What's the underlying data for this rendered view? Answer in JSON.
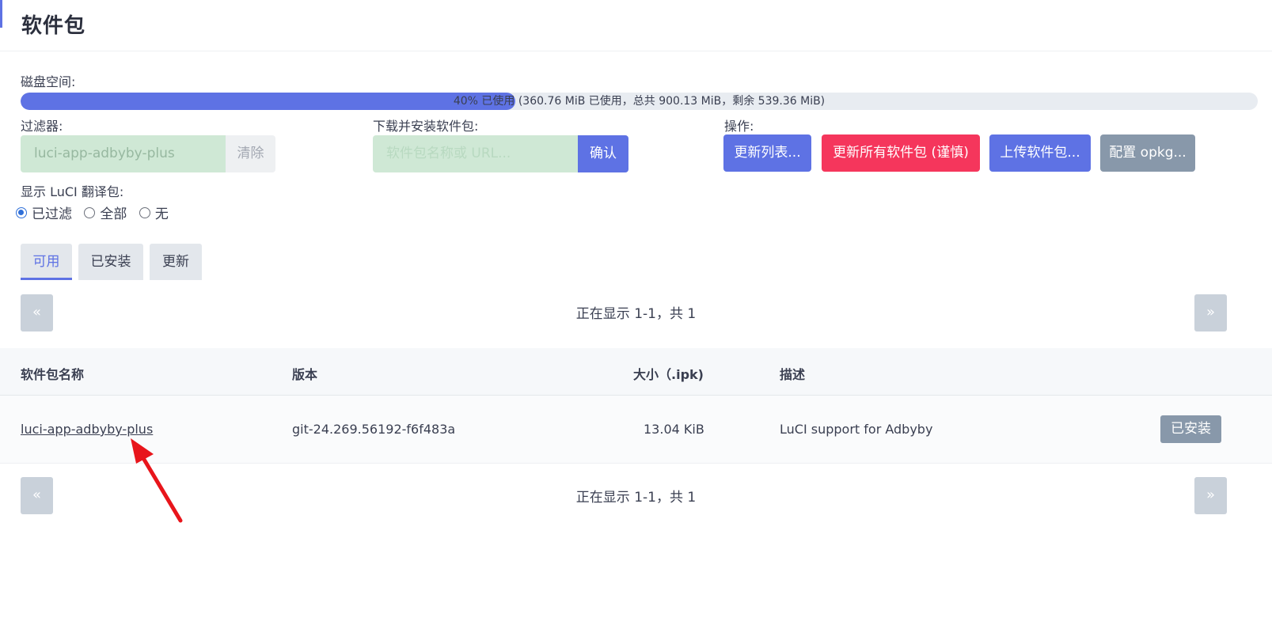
{
  "page": {
    "title": "软件包"
  },
  "disk": {
    "label": "磁盘空间:",
    "usage_text": "40% 已使用 (360.76 MiB 已使用，总共 900.13 MiB，剩余 539.36 MiB)",
    "used_percent": 40,
    "fill_color": "#5e72e4"
  },
  "filter": {
    "label": "过滤器:",
    "value": "luci-app-adbyby-plus",
    "clear_label": "清除"
  },
  "install": {
    "label": "下载并安装软件包:",
    "placeholder": "软件包名称或 URL...",
    "confirm_label": "确认"
  },
  "actions": {
    "label": "操作:",
    "update_lists": "更新列表...",
    "upgrade_all": "更新所有软件包 (谨慎)",
    "upload": "上传软件包...",
    "configure": "配置 opkg..."
  },
  "translations": {
    "label": "显示 LuCI 翻译包:",
    "options": [
      "已过滤",
      "全部",
      "无"
    ],
    "selected": "已过滤"
  },
  "tabs": [
    "可用",
    "已安装",
    "更新"
  ],
  "pager": {
    "prev": "«",
    "next": "»",
    "status": "正在显示 1-1，共 1"
  },
  "table": {
    "headers": {
      "name": "软件包名称",
      "version": "版本",
      "size": "大小（.ipk)",
      "description": "描述"
    },
    "rows": [
      {
        "name": "luci-app-adbyby-plus",
        "version": "git-24.269.56192-f6f483a",
        "size": "13.04 KiB",
        "description": "LuCI support for Adbyby",
        "status": "已安装"
      }
    ]
  },
  "colors": {
    "primary": "#5e72e4",
    "danger": "#f5365c",
    "secondary": "#8898aa",
    "input_bg": "#cfe8d5",
    "annotation_arrow": "#e8151b"
  }
}
